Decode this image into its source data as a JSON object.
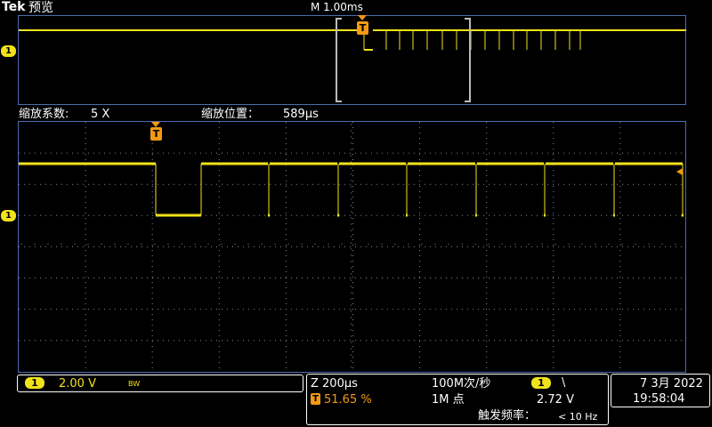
{
  "header": {
    "brand": "Tek",
    "mode": "预览",
    "timebase": "M 1.00ms"
  },
  "zoom_header": {
    "factor_label": "缩放系数:",
    "factor_value": "5 X",
    "position_label": "缩放位置：",
    "position_value": "589µs"
  },
  "markers": {
    "channel": "1",
    "trigger": "T"
  },
  "status": {
    "ch1_num": "1",
    "ch1_scale": "2.00 V",
    "bw": "BW",
    "zoom_scale": "Z 200µs",
    "trig_pos": "51.65 %",
    "sample_rate": "100M次/秒",
    "record_length": "1M 点",
    "trig_source": "1",
    "trig_slope": "\\",
    "trig_level": "2.72 V",
    "trig_freq_label": "触发频率：",
    "trig_freq_value": "< 10 Hz",
    "date": "7 3月 2022",
    "time": "19:58:04"
  },
  "colors": {
    "trace": "#f2e21a",
    "trigger": "#f39a12",
    "grid": "#9a9a9a",
    "frame": "#4a6cb0"
  }
}
